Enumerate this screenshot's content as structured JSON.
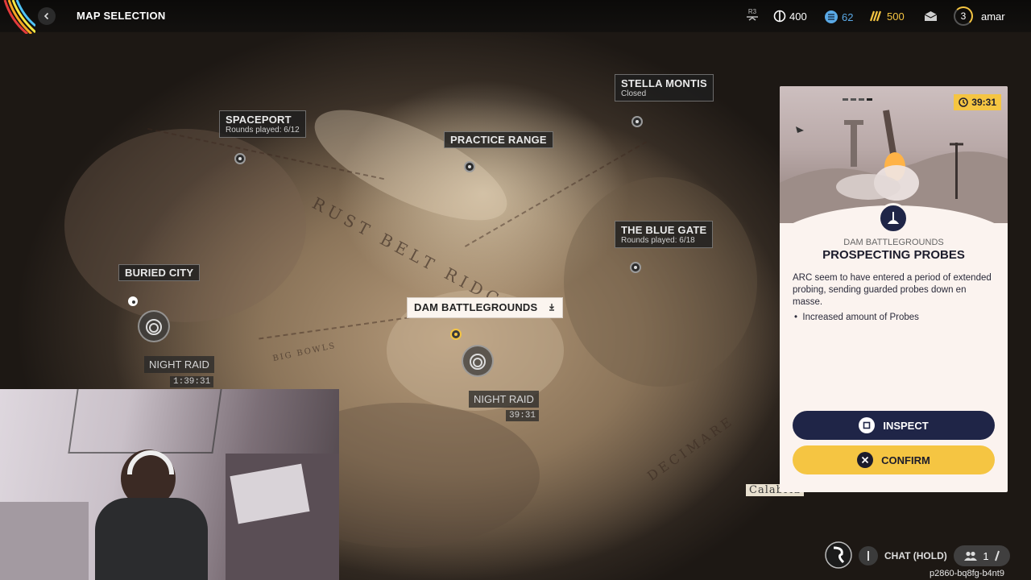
{
  "header": {
    "title": "MAP SELECTION",
    "rank_badge": "R3",
    "currencies": [
      {
        "name": "coins",
        "icon": "coin-icon",
        "value": "400"
      },
      {
        "name": "credits",
        "icon": "credit-icon",
        "value": "62",
        "color": "#5aa9e6"
      },
      {
        "name": "raider-tokens",
        "icon": "token-icon",
        "value": "500",
        "color": "#f5c542"
      }
    ],
    "level": "3",
    "username": "amar"
  },
  "map": {
    "labels": [
      "RUST BELT RIDGE",
      "BIG BOWLS",
      "DECIMARE",
      "Calabria"
    ],
    "locations": [
      {
        "name": "SPACEPORT",
        "sub": "Rounds played: 6/12"
      },
      {
        "name": "PRACTICE RANGE",
        "sub": ""
      },
      {
        "name": "STELLA MONTIS",
        "sub": "Closed"
      },
      {
        "name": "THE BLUE GATE",
        "sub": "Rounds played: 6/18"
      },
      {
        "name": "BURIED CITY",
        "sub": ""
      },
      {
        "name": "DAM BATTLEGROUNDS",
        "sub": ""
      }
    ],
    "conditions": [
      {
        "name": "NIGHT RAID",
        "timer": "1:39:31"
      },
      {
        "name": "NIGHT RAID",
        "timer": "39:31"
      }
    ]
  },
  "card": {
    "timer": "39:31",
    "map_name": "DAM BATTLEGROUNDS",
    "title": "PROSPECTING PROBES",
    "description": "ARC seem to have entered a period of extended probing, sending guarded probes down en masse.",
    "bullet": "Increased amount of Probes",
    "inspect_label": "INSPECT",
    "confirm_label": "CONFIRM"
  },
  "footer": {
    "chat_label": "CHAT (HOLD)",
    "party_count": "1",
    "session_id": "p2860-bq8fg-b4nt9"
  },
  "colors": {
    "accent_yellow": "#f5c542",
    "card_navy": "#1f2547",
    "card_bg": "#fbf3ef"
  }
}
